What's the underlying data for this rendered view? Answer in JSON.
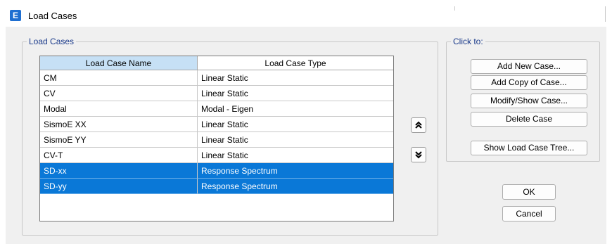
{
  "window": {
    "title": "Load Cases",
    "icon": "E"
  },
  "load_cases_group": {
    "legend": "Load Cases"
  },
  "table": {
    "columns": [
      "Load Case Name",
      "Load Case Type"
    ],
    "rows": [
      {
        "name": "CM",
        "type": "Linear Static",
        "selected": false
      },
      {
        "name": "CV",
        "type": "Linear Static",
        "selected": false
      },
      {
        "name": "Modal",
        "type": "Modal - Eigen",
        "selected": false
      },
      {
        "name": "SismoE XX",
        "type": "Linear Static",
        "selected": false
      },
      {
        "name": "SismoE YY",
        "type": "Linear Static",
        "selected": false
      },
      {
        "name": "CV-T",
        "type": "Linear Static",
        "selected": false
      },
      {
        "name": "SD-xx",
        "type": "Response Spectrum",
        "selected": true
      },
      {
        "name": "SD-yy",
        "type": "Response Spectrum",
        "selected": true
      }
    ]
  },
  "move_buttons": {
    "up_glyph": "⌃⌃",
    "down_glyph": "⌄⌄"
  },
  "click_to_group": {
    "legend": "Click to:",
    "buttons": {
      "add_new": "Add New Case...",
      "add_copy": "Add Copy of Case...",
      "modify_show": "Modify/Show Case...",
      "delete": "Delete Case",
      "show_tree": "Show Load Case Tree..."
    }
  },
  "dialog_buttons": {
    "ok": "OK",
    "cancel": "Cancel"
  },
  "colors": {
    "selection": "#0a78d7",
    "header_highlight": "#c6e0f5",
    "legend_text": "#1a3a8a"
  }
}
